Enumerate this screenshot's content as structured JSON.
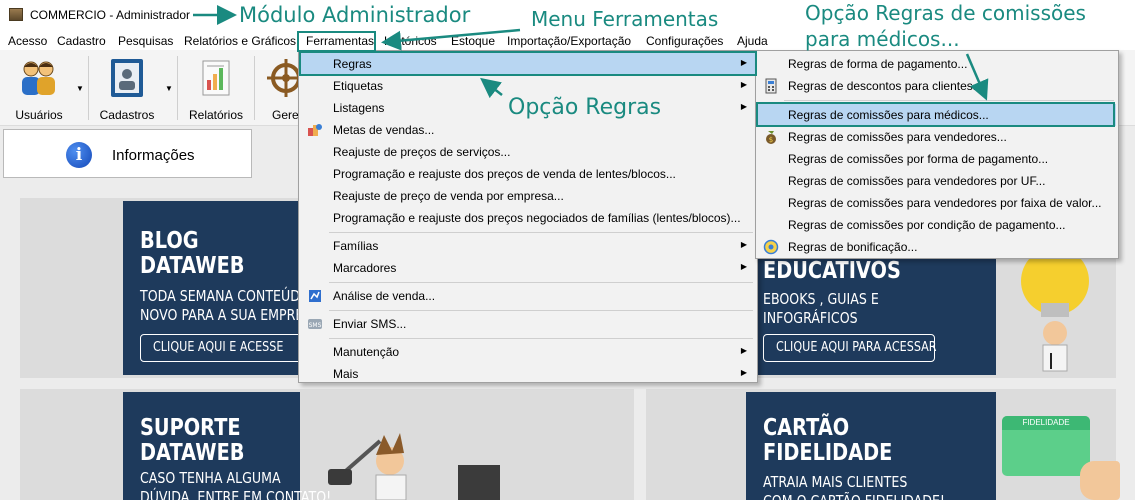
{
  "window": {
    "title": "COMMERCIO - Administrador"
  },
  "menubar": {
    "items": [
      "Acesso",
      "Cadastro",
      "Pesquisas",
      "Relatórios e Gráficos",
      "Ferramentas",
      "Históricos",
      "Estoque",
      "Importação/Exportação",
      "Configurações",
      "Ajuda"
    ]
  },
  "toolbar": {
    "buttons": [
      {
        "label": "Usuários",
        "icon": "users-icon"
      },
      {
        "label": "Cadastros",
        "icon": "contacts-book-icon"
      },
      {
        "label": "Relatórios",
        "icon": "report-chart-icon"
      },
      {
        "label": "Geren",
        "icon": "ship-wheel-icon"
      }
    ]
  },
  "tabs": {
    "info_label": "Informações",
    "info_icon": "info-icon"
  },
  "ferramentas_menu": {
    "items": [
      {
        "label": "Regras",
        "submenu": true
      },
      {
        "label": "Etiquetas",
        "submenu": true
      },
      {
        "label": "Listagens",
        "submenu": true
      },
      {
        "label": "Metas de vendas...",
        "icon": "sales-goal-icon"
      },
      {
        "label": "Reajuste de preços de serviços..."
      },
      {
        "label": "Programação e reajuste dos preços de venda de lentes/blocos..."
      },
      {
        "label": "Reajuste de preço de venda por empresa..."
      },
      {
        "label": "Programação e reajuste dos preços negociados de famílias (lentes/blocos)..."
      },
      {
        "label": "Famílias",
        "submenu": true
      },
      {
        "label": "Marcadores",
        "submenu": true
      },
      {
        "label": "Análise de venda...",
        "icon": "sales-analysis-icon"
      },
      {
        "label": "Enviar SMS...",
        "icon": "sms-icon"
      },
      {
        "label": "Manutenção",
        "submenu": true
      },
      {
        "label": "Mais",
        "submenu": true
      }
    ]
  },
  "regras_submenu": {
    "items": [
      {
        "label": "Regras de forma de pagamento..."
      },
      {
        "label": "Regras de descontos para clientes...",
        "icon": "discount-calculator-icon"
      },
      {
        "label": "Regras de comissões para médicos..."
      },
      {
        "label": "Regras de comissões para vendedores...",
        "icon": "money-bag-icon"
      },
      {
        "label": "Regras de comissões por forma de pagamento..."
      },
      {
        "label": "Regras de comissões para vendedores por UF..."
      },
      {
        "label": "Regras de comissões para vendedores por faixa de valor..."
      },
      {
        "label": "Regras de comissões por condição de pagamento..."
      },
      {
        "label": "Regras de bonificação...",
        "icon": "bonus-icon"
      }
    ]
  },
  "banners": {
    "blog": {
      "title": [
        "BLOG",
        "DATAWEB"
      ],
      "text": [
        "TODA SEMANA CONTEÚDO",
        "NOVO PARA A SUA EMPRESA"
      ],
      "button": "CLIQUE AQUI E ACESSE"
    },
    "educativos": {
      "title": "EDUCATIVOS",
      "text": [
        "EBOOKS , GUIAS E",
        "INFOGRÁFICOS"
      ],
      "button": "CLIQUE AQUI PARA ACESSAR"
    },
    "suporte": {
      "title": [
        "SUPORTE",
        "DATAWEB"
      ],
      "text": [
        "CASO TENHA ALGUMA",
        "DÚVIDA, ENTRE EM CONTATO!"
      ]
    },
    "cartao": {
      "title": [
        "CARTÃO",
        "FIDELIDADE"
      ],
      "text": [
        "ATRAIA MAIS CLIENTES",
        "COM O CARTÃO FIDELIDADE!"
      ],
      "card_label": "FIDELIDADE"
    }
  },
  "annotations": {
    "modulo": "Módulo Administrador",
    "menu": "Menu Ferramentas",
    "regras": "Opção Regras",
    "comissoes": [
      "Opção Regras de comissões",
      "para médicos..."
    ]
  },
  "colors": {
    "annotation": "#1a8a80",
    "banner_navy": "#1e3a5c",
    "menu_highlight": "#b8d6f2"
  }
}
